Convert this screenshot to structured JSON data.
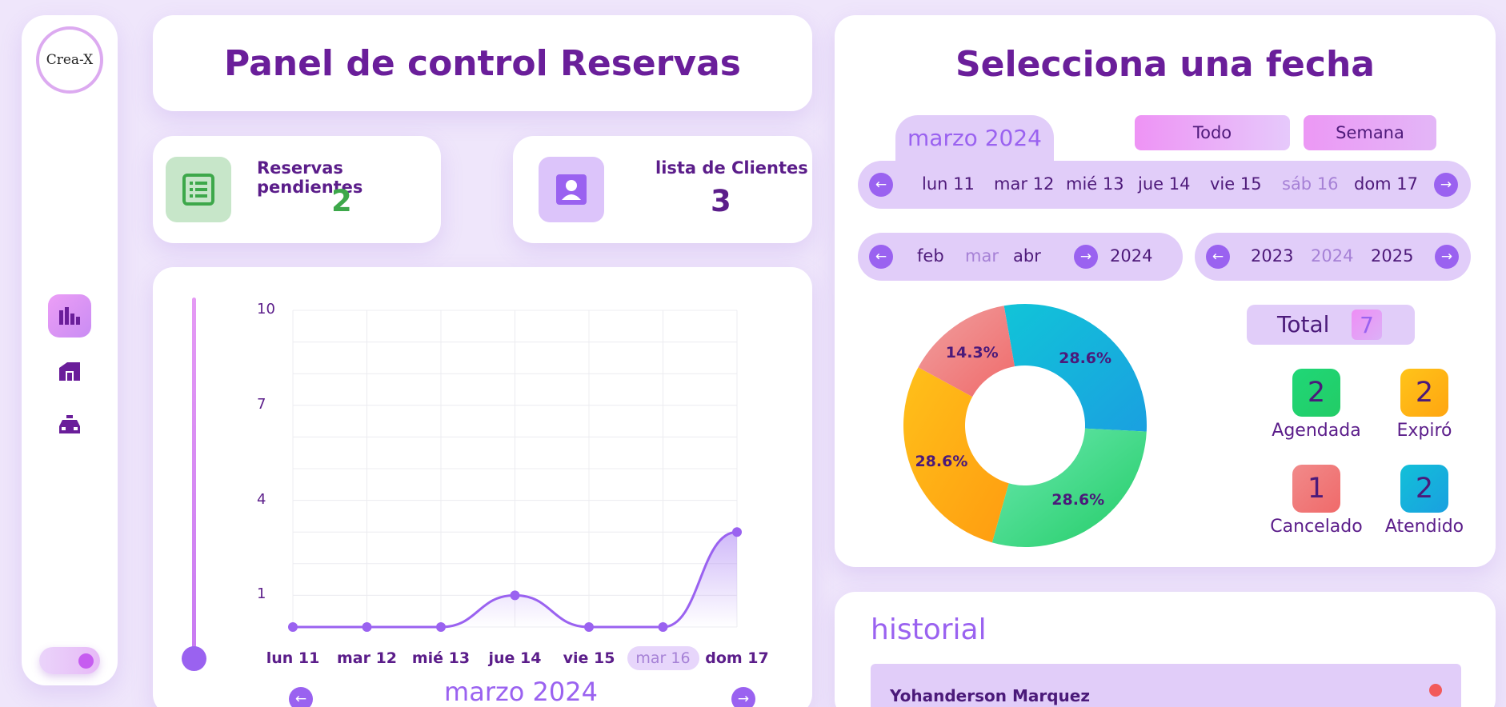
{
  "sidebar": {
    "logo_text": "Crea-X",
    "items": [
      {
        "icon": "bar-chart-icon",
        "active": true
      },
      {
        "icon": "store-icon",
        "active": false
      },
      {
        "icon": "taxi-icon",
        "active": false
      }
    ]
  },
  "header": {
    "title": "Panel de control Reservas"
  },
  "stats": {
    "pending": {
      "label": "Reservas pendientes",
      "value": "2",
      "color": "#3da84a"
    },
    "clients": {
      "label": "lista de Clientes",
      "value": "3",
      "color": "#5b1d8a"
    }
  },
  "chart_data": {
    "type": "line",
    "categories": [
      "lun 11",
      "mar 12",
      "mié 13",
      "jue 14",
      "vie 15",
      "mar 16",
      "dom 17"
    ],
    "values": [
      0,
      0,
      0,
      1,
      0,
      0,
      3
    ],
    "yticks": [
      "10",
      "7",
      "4",
      "1"
    ],
    "ylim": [
      0,
      10
    ],
    "highlight_category": "mar 16",
    "color": "#9a62f0"
  },
  "chart_footer": {
    "month": "marzo 2024"
  },
  "date_panel": {
    "title": "Selecciona una fecha",
    "month_tab": "marzo 2024",
    "buttons": [
      "Todo",
      "Semana"
    ],
    "days": [
      "lun 11",
      "mar 12",
      "mié 13",
      "jue 14",
      "vie 15",
      "sáb 16",
      "dom 17"
    ],
    "selected_day": "sáb 16",
    "months": [
      "feb",
      "mar",
      "abr"
    ],
    "selected_month": "mar",
    "current_year_label": "2024",
    "years": [
      "2023",
      "2024",
      "2025"
    ],
    "selected_year": "2024"
  },
  "donut": {
    "chart_data": {
      "type": "pie",
      "labels": [
        "Atendido",
        "Agendada",
        "Expiró",
        "Cancelado"
      ],
      "values": [
        28.6,
        28.6,
        28.6,
        14.3
      ],
      "colors": [
        "#1aa0e0",
        "#22cc66",
        "#ff9c10",
        "#f06a6a"
      ]
    },
    "slice_labels": [
      "28.6%",
      "28.6%",
      "28.6%",
      "14.3%"
    ]
  },
  "totals": {
    "total_label": "Total",
    "total_value": "7",
    "items": [
      {
        "label": "Agendada",
        "value": "2",
        "color": "#22cc66"
      },
      {
        "label": "Expiró",
        "value": "2",
        "color": "#ffa510"
      },
      {
        "label": "Cancelado",
        "value": "1",
        "color": "#f06a6a"
      },
      {
        "label": "Atendido",
        "value": "2",
        "color": "#1aa0e0"
      }
    ]
  },
  "history": {
    "title": "historial",
    "entries": [
      {
        "name": "Yohanderson Marquez",
        "status_color": "#f25a5a"
      }
    ]
  }
}
